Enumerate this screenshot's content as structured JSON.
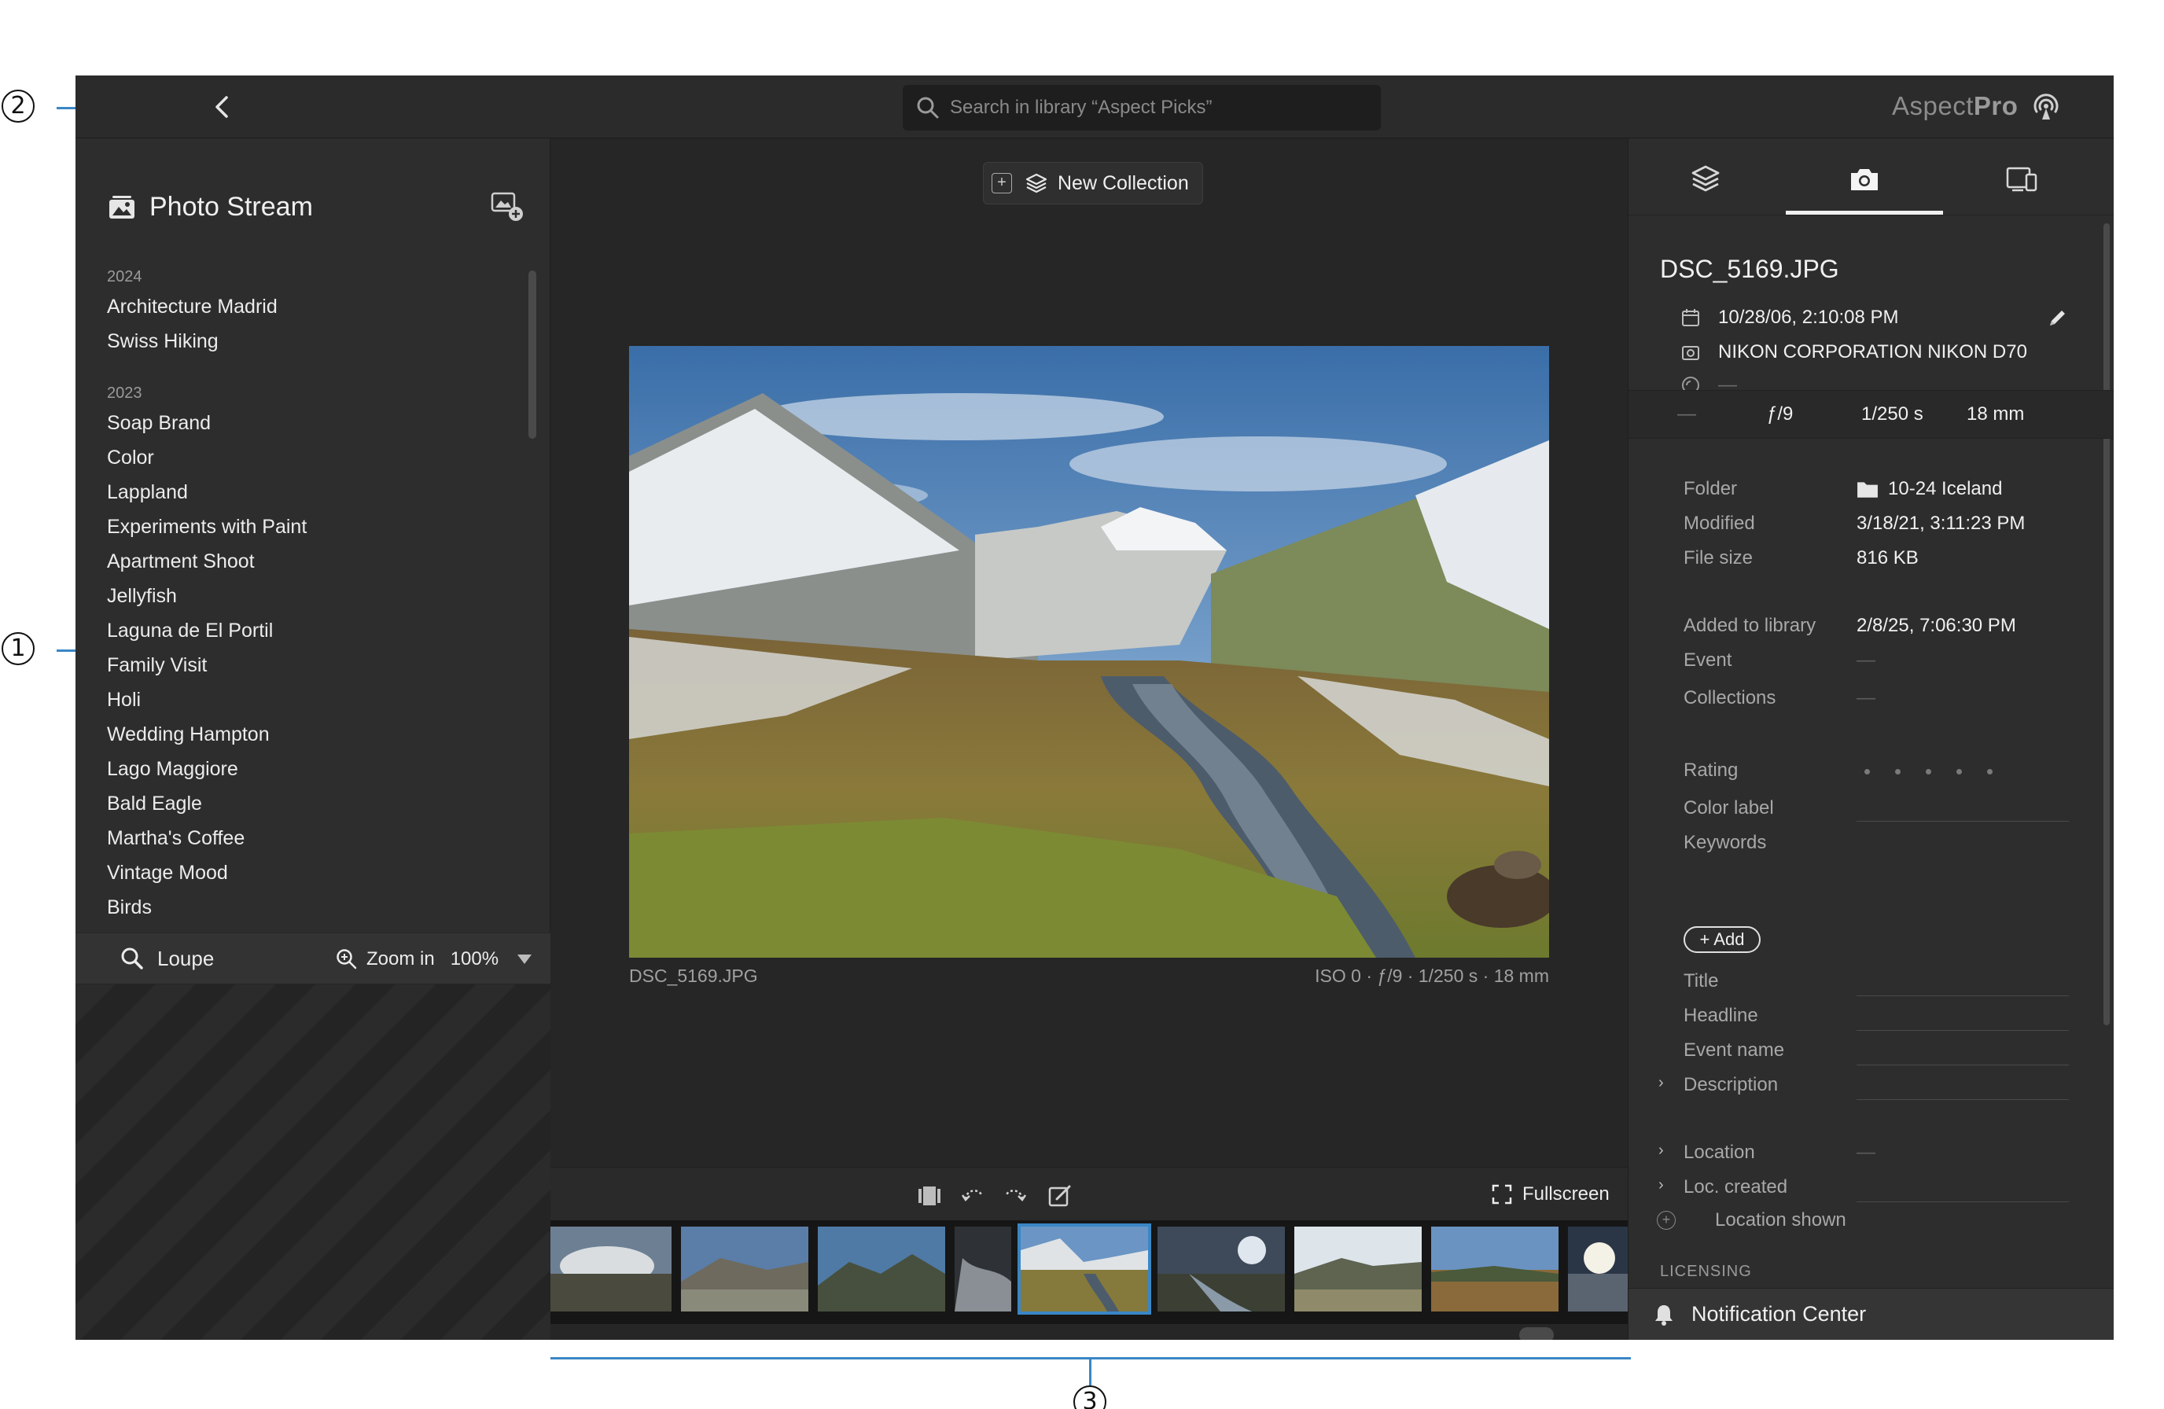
{
  "callouts": [
    "1",
    "2",
    "3"
  ],
  "topbar": {
    "search_placeholder": "Search in library “Aspect Picks”",
    "brand_light": "Aspect",
    "brand_bold": "Pro"
  },
  "sidebar": {
    "title": "Photo Stream",
    "groups": [
      {
        "year": "2024",
        "items": [
          "Architecture Madrid",
          "Swiss Hiking"
        ]
      },
      {
        "year": "2023",
        "items": [
          "Soap Brand",
          "Color",
          "Lappland",
          "Experiments with Paint",
          "Apartment Shoot",
          "Jellyfish",
          "Laguna de El Portil",
          "Family Visit",
          "Holi",
          "Wedding Hampton",
          "Lago Maggiore",
          "Bald Eagle",
          "Martha's Coffee",
          "Vintage Mood",
          "Birds"
        ]
      }
    ],
    "view_mode": "Loupe",
    "zoom_label": "Zoom in",
    "zoom_value": "100%"
  },
  "center": {
    "new_collection": "New Collection",
    "caption_left": "DSC_5169.JPG",
    "caption_right": "ISO 0 · ƒ/9 · 1/250 s · 18 mm",
    "fullscreen": "Fullscreen"
  },
  "filmstrip": {
    "selected_index": 4,
    "count": 9
  },
  "info": {
    "filename": "DSC_5169.JPG",
    "date": "10/28/06, 2:10:08 PM",
    "camera": "NIKON CORPORATION NIKON D70",
    "lens": "—",
    "exif": [
      "—",
      "ƒ/9",
      "1/250 s",
      "18 mm"
    ],
    "folder_label": "Folder",
    "folder_value": "10-24 Iceland",
    "modified_label": "Modified",
    "modified_value": "3/18/21, 3:11:23 PM",
    "filesize_label": "File size",
    "filesize_value": "816 KB",
    "added_label": "Added to library",
    "added_value": "2/8/25, 7:06:30 PM",
    "event_label": "Event",
    "event_value": "—",
    "collections_label": "Collections",
    "collections_value": "—",
    "rating_label": "Rating",
    "colorlabel_label": "Color label",
    "keywords_label": "Keywords",
    "add_button": "+ Add",
    "title_label": "Title",
    "headline_label": "Headline",
    "eventname_label": "Event name",
    "description_label": "Description",
    "location_label": "Location",
    "location_value": "—",
    "loccreated_label": "Loc. created",
    "locshown_label": "Location shown",
    "licensing_header": "LICENSING"
  },
  "notification": "Notification Center",
  "colors": {
    "accent": "#3a86c6",
    "background": "#262626",
    "panel": "#2d2d2d"
  }
}
